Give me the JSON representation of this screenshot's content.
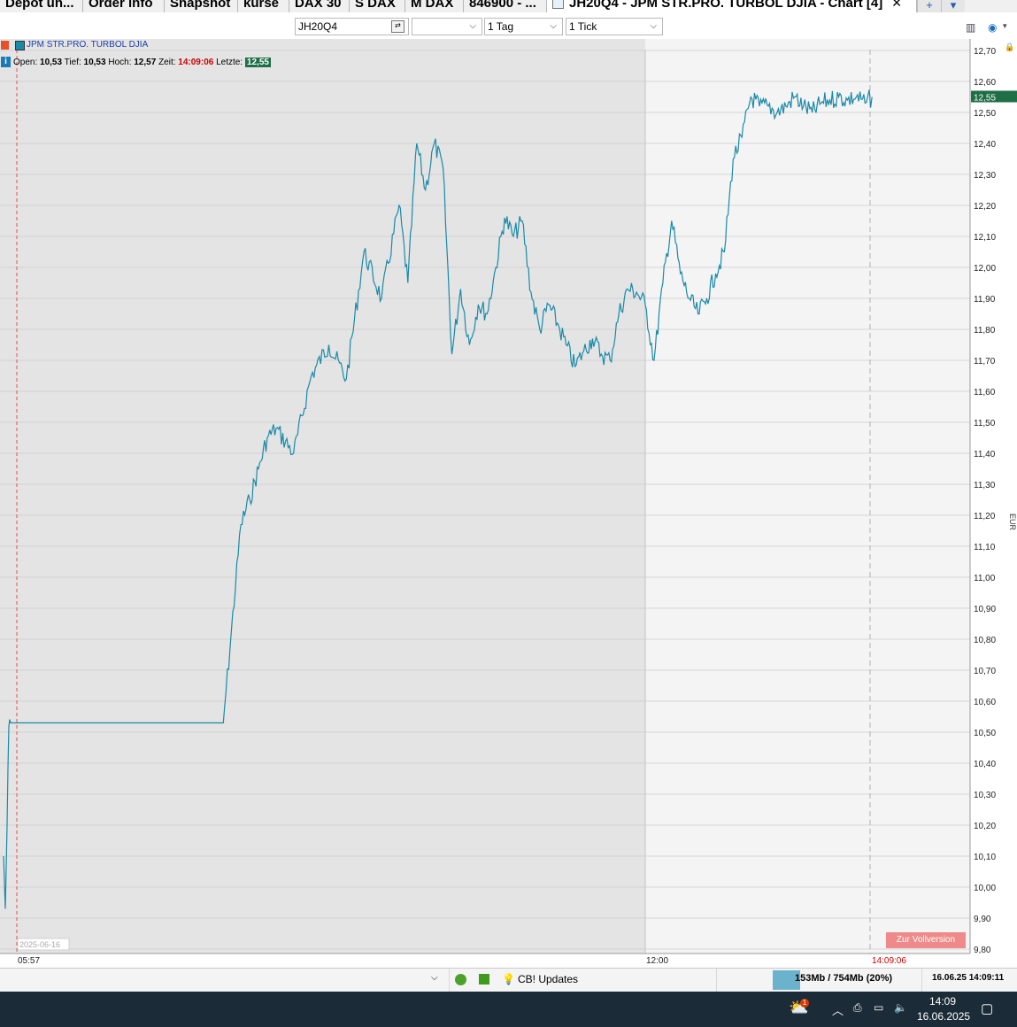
{
  "tabs": [
    {
      "label": "Depot un..."
    },
    {
      "label": "Order info"
    },
    {
      "label": "Snapshot"
    },
    {
      "label": "kurse"
    },
    {
      "label": "DAX 30"
    },
    {
      "label": "S DAX"
    },
    {
      "label": "M DAX"
    },
    {
      "label": "846900 - ..."
    },
    {
      "label": "JH20Q4 - JPM STR.PRO. TURBOL DJIA - Chart [4]",
      "close": "✕",
      "active": true
    }
  ],
  "tab_buttons": {
    "add": "+",
    "menu": "▾"
  },
  "toolbar": {
    "symbol_value": "JH20Q4",
    "empty_select_value": "",
    "period_value": "1 Tag",
    "interval_value": "1 Tick"
  },
  "legend": {
    "series_name": "JPM STR.PRO. TURBOL DJIA",
    "series_color": "#1a8aa8"
  },
  "info": {
    "icon": "i",
    "open_label": "Open:",
    "open_value": "10,53",
    "low_label": "Tief:",
    "low_value": "10,53",
    "high_label": "Hoch:",
    "high_value": "12,57",
    "time_label": "Zeit:",
    "time_value": "14:09:06",
    "last_label": "Letzte:",
    "last_value": "12,55"
  },
  "axis": {
    "unit": "EUR"
  },
  "zur_button": "Zur Vollversion",
  "statusbar": {
    "cb_updates": "CB! Updates",
    "memory": "153Mb / 754Mb (20%)",
    "datetime": "16.06.25 14:09:11"
  },
  "taskbar": {
    "time": "14:09",
    "date": "16.06.2025",
    "notification_badge": "1"
  },
  "colors": {
    "line": "#1a8aa8",
    "last_price_bg": "#1e6e46",
    "session_shade": "#e4e4e4",
    "post_shade": "#f4f4f4",
    "accent_red": "#d00000"
  },
  "chart_data": {
    "type": "line",
    "title": "JPM STR.PRO. TURBOL DJIA",
    "ylabel": "EUR",
    "ylim": [
      9.8,
      12.7
    ],
    "yticks": [
      "12,70",
      "12,60",
      "12,50",
      "12,40",
      "12,30",
      "12,20",
      "12,10",
      "12,00",
      "11,90",
      "11,80",
      "11,70",
      "11,60",
      "11,50",
      "11,40",
      "11,30",
      "11,20",
      "11,10",
      "11,00",
      "10,90",
      "10,80",
      "10,70",
      "10,60",
      "10,50",
      "10,40",
      "10,30",
      "10,20",
      "10,10",
      "10,00",
      "9,90",
      "9,80"
    ],
    "ytick_values": [
      12.7,
      12.6,
      12.5,
      12.4,
      12.3,
      12.2,
      12.1,
      12.0,
      11.9,
      11.8,
      11.7,
      11.6,
      11.5,
      11.4,
      11.3,
      11.2,
      11.1,
      11.0,
      10.9,
      10.8,
      10.7,
      10.6,
      10.5,
      10.4,
      10.3,
      10.2,
      10.1,
      10.0,
      9.9,
      9.8
    ],
    "xticks": [
      {
        "label": "05:57",
        "t": "05:57"
      },
      {
        "label": "12:00",
        "t": "12:00"
      }
    ],
    "date_label": "2025-06-16",
    "current_time": "14:09:06",
    "current_price_label": "12,55",
    "current_price": 12.55,
    "series": [
      {
        "name": "JPM STR.PRO. TURBOL DJIA",
        "x": [
          "05:55",
          "05:56",
          "05:57",
          "05:58",
          "05:59",
          "06:00",
          "06:10",
          "08:00",
          "08:10",
          "08:15",
          "08:20",
          "08:25",
          "08:30",
          "08:40",
          "08:50",
          "09:00",
          "09:10",
          "09:20",
          "09:30",
          "09:40",
          "09:45",
          "09:50",
          "09:55",
          "10:00",
          "10:05",
          "10:10",
          "10:15",
          "10:20",
          "10:25",
          "10:30",
          "10:35",
          "10:40",
          "10:45",
          "10:50",
          "10:55",
          "11:00",
          "11:05",
          "11:10",
          "11:15",
          "11:20",
          "11:25",
          "11:30",
          "11:35",
          "11:40",
          "11:45",
          "11:50",
          "11:55",
          "12:00",
          "12:05",
          "12:10",
          "12:15",
          "12:20",
          "12:25",
          "12:30",
          "12:35",
          "12:40",
          "12:45",
          "12:50",
          "12:55",
          "13:00",
          "13:05",
          "13:10",
          "13:15",
          "13:20",
          "13:25",
          "13:30",
          "13:35",
          "13:40",
          "13:45",
          "13:50",
          "13:55",
          "14:00",
          "14:05",
          "14:09"
        ],
        "y": [
          10.1,
          9.93,
          10.2,
          10.52,
          10.53,
          10.53,
          10.53,
          10.53,
          11.17,
          11.25,
          11.35,
          11.45,
          11.48,
          11.4,
          11.65,
          11.75,
          11.64,
          12.05,
          11.9,
          12.2,
          11.95,
          12.4,
          12.25,
          12.4,
          12.32,
          11.72,
          11.93,
          11.75,
          11.88,
          11.85,
          12.0,
          12.16,
          12.1,
          12.15,
          11.92,
          11.8,
          11.88,
          11.82,
          11.75,
          11.68,
          11.73,
          11.77,
          11.72,
          11.7,
          11.85,
          11.93,
          11.92,
          11.88,
          11.7,
          11.95,
          12.15,
          11.98,
          11.9,
          11.85,
          11.9,
          11.98,
          12.05,
          12.35,
          12.42,
          12.55,
          12.52,
          12.52,
          12.5,
          12.52,
          12.55,
          12.52,
          12.5,
          12.53,
          12.54,
          12.55,
          12.54,
          12.55,
          12.53,
          12.55
        ]
      }
    ]
  }
}
